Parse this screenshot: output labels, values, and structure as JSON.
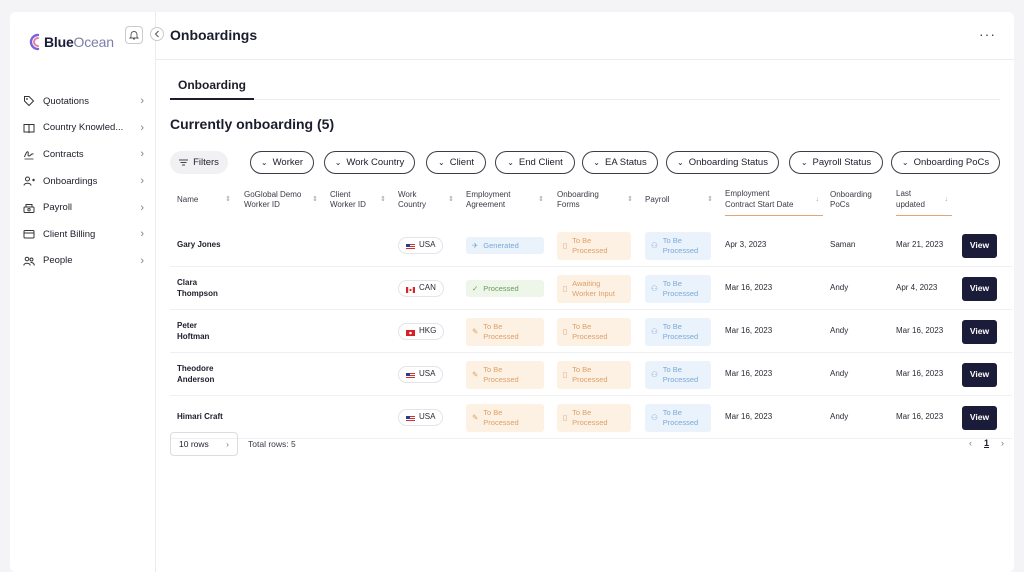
{
  "brand": {
    "name_bold": "Blue",
    "name_light": "Ocean"
  },
  "sidebar": {
    "items": [
      {
        "label": "Quotations",
        "icon": "tag-icon"
      },
      {
        "label": "Country Knowled...",
        "icon": "book-icon"
      },
      {
        "label": "Contracts",
        "icon": "signature-icon"
      },
      {
        "label": "Onboardings",
        "icon": "user-add-icon"
      },
      {
        "label": "Payroll",
        "icon": "money-icon"
      },
      {
        "label": "Client Billing",
        "icon": "card-icon"
      },
      {
        "label": "People",
        "icon": "people-icon"
      }
    ]
  },
  "header": {
    "title": "Onboardings",
    "more": "···"
  },
  "tabs": [
    {
      "label": "Onboarding",
      "active": true
    }
  ],
  "section": {
    "title": "Currently onboarding (5)"
  },
  "filters": {
    "button": "Filters",
    "chips": [
      "Worker",
      "Work Country",
      "Client",
      "End Client",
      "EA Status",
      "Onboarding Status",
      "Payroll Status",
      "Onboarding PoCs"
    ]
  },
  "table": {
    "columns": [
      {
        "l1": "Name",
        "l2": ""
      },
      {
        "l1": "GoGlobal Demo",
        "l2": "Worker ID"
      },
      {
        "l1": "Client",
        "l2": "Worker ID"
      },
      {
        "l1": "Work",
        "l2": "Country"
      },
      {
        "l1": "Employment",
        "l2": "Agreement"
      },
      {
        "l1": "Onboarding",
        "l2": "Forms"
      },
      {
        "l1": "Payroll",
        "l2": ""
      },
      {
        "l1": "Employment",
        "l2": "Contract Start Date"
      },
      {
        "l1": "Onboarding",
        "l2": "PoCs"
      },
      {
        "l1": "Last",
        "l2": "updated"
      }
    ],
    "rows": [
      {
        "name1": "Gary Jones",
        "name2": "",
        "country": "USA",
        "ea": {
          "l1": "Generated",
          "l2": "",
          "tone": "blue"
        },
        "forms": {
          "l1": "To Be",
          "l2": "Processed"
        },
        "payroll": {
          "l1": "To Be",
          "l2": "Processed"
        },
        "start": "Apr 3, 2023",
        "poc": "Saman",
        "updated": "Mar 21, 2023",
        "action": "View"
      },
      {
        "name1": "Clara",
        "name2": "Thompson",
        "country": "CAN",
        "ea": {
          "l1": "Processed",
          "l2": "",
          "tone": "green"
        },
        "forms": {
          "l1": "Awaiting",
          "l2": "Worker Input"
        },
        "payroll": {
          "l1": "To Be",
          "l2": "Processed"
        },
        "start": "Mar 16, 2023",
        "poc": "Andy",
        "updated": "Apr 4, 2023",
        "action": "View"
      },
      {
        "name1": "Peter",
        "name2": "Hoftman",
        "country": "HKG",
        "ea": {
          "l1": "To Be",
          "l2": "Processed",
          "tone": "orange"
        },
        "forms": {
          "l1": "To Be",
          "l2": "Processed"
        },
        "payroll": {
          "l1": "To Be",
          "l2": "Processed"
        },
        "start": "Mar 16, 2023",
        "poc": "Andy",
        "updated": "Mar 16, 2023",
        "action": "View"
      },
      {
        "name1": "Theodore",
        "name2": "Anderson",
        "country": "USA",
        "ea": {
          "l1": "To Be",
          "l2": "Processed",
          "tone": "orange"
        },
        "forms": {
          "l1": "To Be",
          "l2": "Processed"
        },
        "payroll": {
          "l1": "To Be",
          "l2": "Processed"
        },
        "start": "Mar 16, 2023",
        "poc": "Andy",
        "updated": "Mar 16, 2023",
        "action": "View"
      },
      {
        "name1": "Himari Craft",
        "name2": "",
        "country": "USA",
        "ea": {
          "l1": "To Be",
          "l2": "Processed",
          "tone": "orange"
        },
        "forms": {
          "l1": "To Be",
          "l2": "Processed"
        },
        "payroll": {
          "l1": "To Be",
          "l2": "Processed"
        },
        "start": "Mar 16, 2023",
        "poc": "Andy",
        "updated": "Mar 16, 2023",
        "action": "View"
      }
    ]
  },
  "pagination": {
    "rows_per_page": "10 rows",
    "total": "Total rows: 5",
    "prev": "‹",
    "page": "1",
    "next": "›"
  },
  "colors": {
    "primary_dark": "#1b1b3a",
    "accent_underline": "#e0a57a"
  }
}
